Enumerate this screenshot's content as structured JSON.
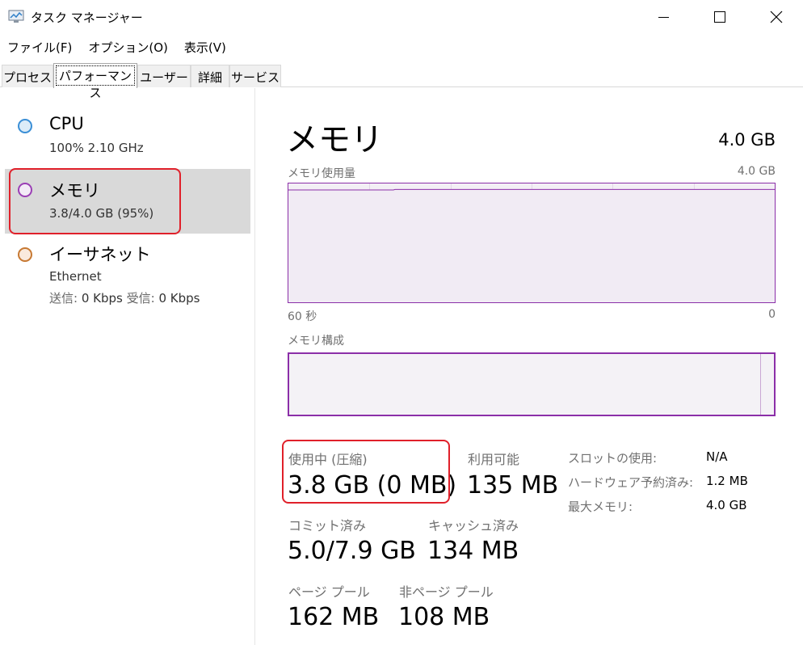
{
  "window": {
    "title": "タスク マネージャー"
  },
  "menu": [
    "ファイル(F)",
    "オプション(O)",
    "表示(V)"
  ],
  "tabs": [
    {
      "label": "プロセス",
      "active": false
    },
    {
      "label": "パフォーマンス",
      "active": true
    },
    {
      "label": "ユーザー",
      "active": false
    },
    {
      "label": "詳細",
      "active": false
    },
    {
      "label": "サービス",
      "active": false
    }
  ],
  "resources": [
    {
      "name": "CPU",
      "sub": "100%  2.10 GHz",
      "color": "#3b8fd6",
      "fill": "#dcecf8"
    },
    {
      "name": "メモリ",
      "sub": "3.8/4.0 GB (95%)",
      "color": "#9b3fb5",
      "fill": "#f4ecf7"
    },
    {
      "name": "イーサネット",
      "sub": "Ethernet",
      "sub2": {
        "send_label": "送信:",
        "send_value": "0 Kbps",
        "recv_label": "受信:",
        "recv_value": "0 Kbps"
      },
      "color": "#c77933",
      "fill": "#faeadd"
    }
  ],
  "detail": {
    "title": "メモリ",
    "total": "4.0 GB",
    "usage_label": "メモリ使用量",
    "usage_max": "4.0 GB",
    "axis_left": "60 秒",
    "axis_right": "0",
    "composition_label": "メモリ構成",
    "usage_fraction": 0.95,
    "accent_color": "#8b2fa8"
  },
  "stats": {
    "in_use_label": "使用中 (圧縮)",
    "in_use_value": "3.8 GB (0 MB)",
    "available_label": "利用可能",
    "available_value": "135 MB",
    "committed_label": "コミット済み",
    "committed_value": "5.0/7.9 GB",
    "cached_label": "キャッシュ済み",
    "cached_value": "134 MB",
    "paged_label": "ページ プール",
    "paged_value": "162 MB",
    "nonpaged_label": "非ページ プール",
    "nonpaged_value": "108 MB",
    "slots_label": "スロットの使用:",
    "slots_value": "N/A",
    "hw_reserved_label": "ハードウェア予約済み:",
    "hw_reserved_value": "1.2 MB",
    "max_mem_label": "最大メモリ:",
    "max_mem_value": "4.0 GB"
  }
}
